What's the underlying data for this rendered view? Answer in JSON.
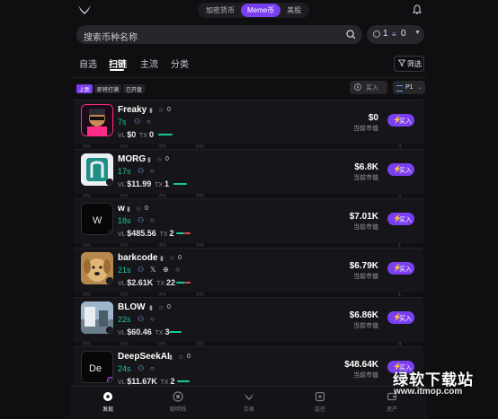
{
  "topbar": {
    "tabs": [
      "加密货币",
      "Meme币",
      "美股"
    ],
    "active_tab": 1
  },
  "search": {
    "placeholder": "搜索币种名称"
  },
  "wallet": {
    "left_value": "1",
    "right_value": "0"
  },
  "tabs": [
    {
      "label": "自选",
      "active": false
    },
    {
      "label": "扫链",
      "active": true
    },
    {
      "label": "主流",
      "active": false
    },
    {
      "label": "分类",
      "active": false
    }
  ],
  "filter_label": "筛选",
  "subfilters": [
    {
      "label": "上新",
      "active": true
    },
    {
      "label": "即将打满",
      "active": false
    },
    {
      "label": "已开盘",
      "active": false
    }
  ],
  "buy_input": {
    "placeholder": "买入"
  },
  "preset": {
    "label": "P1"
  },
  "buy_label": "买入",
  "market_cap_label": "当前市值",
  "vol_prefix": "VL",
  "tx_prefix": "TX",
  "colors": {
    "accent": "#7b3ff2",
    "green": "#18c79a",
    "red": "#e2474f"
  },
  "tokens": [
    {
      "name": "Freaky",
      "likes": "0",
      "age": "7s",
      "vol": "$0",
      "tx": "0",
      "price": "$0",
      "extra_icon": "",
      "bar": "green",
      "avatar": "dark-pink"
    },
    {
      "name": "MORG",
      "likes": "0",
      "age": "17s",
      "vol": "$11.99",
      "tx": "1",
      "price": "$6.8K",
      "extra_icon": "",
      "bar": "green",
      "avatar": "teal"
    },
    {
      "name": "w",
      "likes": "0",
      "age": "18s",
      "vol": "$485.56",
      "tx": "2",
      "price": "$7.01K",
      "extra_icon": "",
      "bar": "mixed",
      "avatar": "black"
    },
    {
      "name": "barkcode",
      "likes": "0",
      "age": "21s",
      "vol": "$2.61K",
      "tx": "22",
      "price": "$6.79K",
      "extra_icon": "globe",
      "bar": "mixed",
      "avatar": "dog"
    },
    {
      "name": "BLOW",
      "likes": "0",
      "age": "22s",
      "vol": "$60.46",
      "tx": "3",
      "price": "$6.86K",
      "extra_icon": "",
      "bar": "green",
      "avatar": "photo"
    },
    {
      "name": "DeepSeekAI",
      "likes": "0",
      "age": "24s",
      "vol": "$11.67K",
      "tx": "2",
      "price": "$48.64K",
      "extra_icon": "",
      "bar": "green",
      "avatar": "black-de"
    }
  ],
  "strip_values": {
    "percent": "0%",
    "right_counts": [
      "0",
      "2",
      "1",
      "1",
      "4"
    ]
  },
  "bottom_nav": [
    {
      "label": "发现",
      "icon": "discover-icon",
      "active": true
    },
    {
      "label": "聪明钱",
      "icon": "smart-money-icon",
      "active": false
    },
    {
      "label": "交易",
      "icon": "trade-icon",
      "active": false
    },
    {
      "label": "监控",
      "icon": "monitor-icon",
      "active": false
    },
    {
      "label": "资产",
      "icon": "assets-icon",
      "active": false
    }
  ],
  "watermark": {
    "title": "绿软下载站",
    "url": "www.itmop.com"
  }
}
